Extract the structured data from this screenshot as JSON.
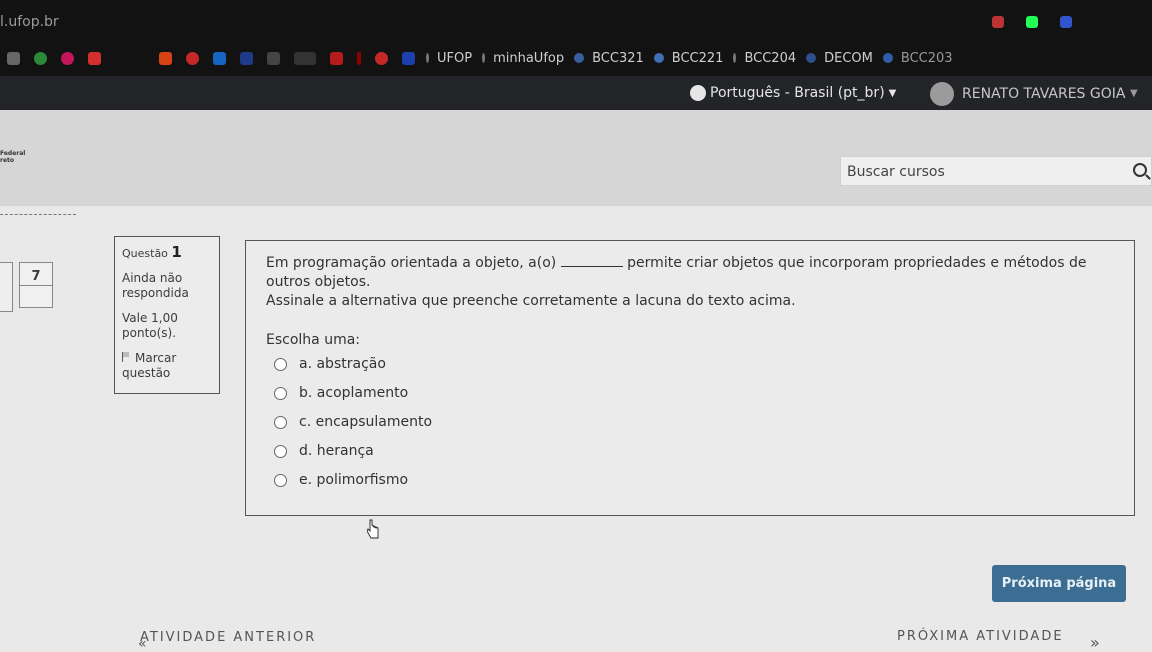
{
  "browser": {
    "url": "l.ufop.br",
    "bookmarks": [
      {
        "label": "UFOP"
      },
      {
        "label": "minhaUfop"
      },
      {
        "label": "BCC321"
      },
      {
        "label": "BCC221"
      },
      {
        "label": "BCC204"
      },
      {
        "label": "DECOM"
      },
      {
        "label": "BCC203"
      }
    ]
  },
  "navbar": {
    "language": "Português - Brasil (pt_br)",
    "user": "RENATO TAVARES GOIA"
  },
  "header": {
    "logo_text": "Federal",
    "logo_text2": "reto",
    "search_placeholder": "Buscar cursos"
  },
  "question_nav": {
    "current": "7"
  },
  "question_info": {
    "label": "Questão",
    "number": "1",
    "status": "Ainda não respondida",
    "points": "Vale 1,00 ponto(s).",
    "flag": "Marcar questão"
  },
  "question": {
    "text_before": "Em programação orientada a objeto, a(o)",
    "text_after": "permite criar objetos que incorporam propriedades e métodos de outros objetos.",
    "instruction": "Assinale a alternativa que preenche corretamente a lacuna do texto acima.",
    "prompt": "Escolha uma:",
    "options": [
      {
        "label": "a. abstração"
      },
      {
        "label": "b. acoplamento"
      },
      {
        "label": "c. encapsulamento"
      },
      {
        "label": "d. herança"
      },
      {
        "label": "e. polimorfismo"
      }
    ]
  },
  "footer": {
    "next_page": "Próxima página",
    "prev_activity": "ATIVIDADE ANTERIOR",
    "next_activity": "PRÓXIMA ATIVIDADE"
  }
}
